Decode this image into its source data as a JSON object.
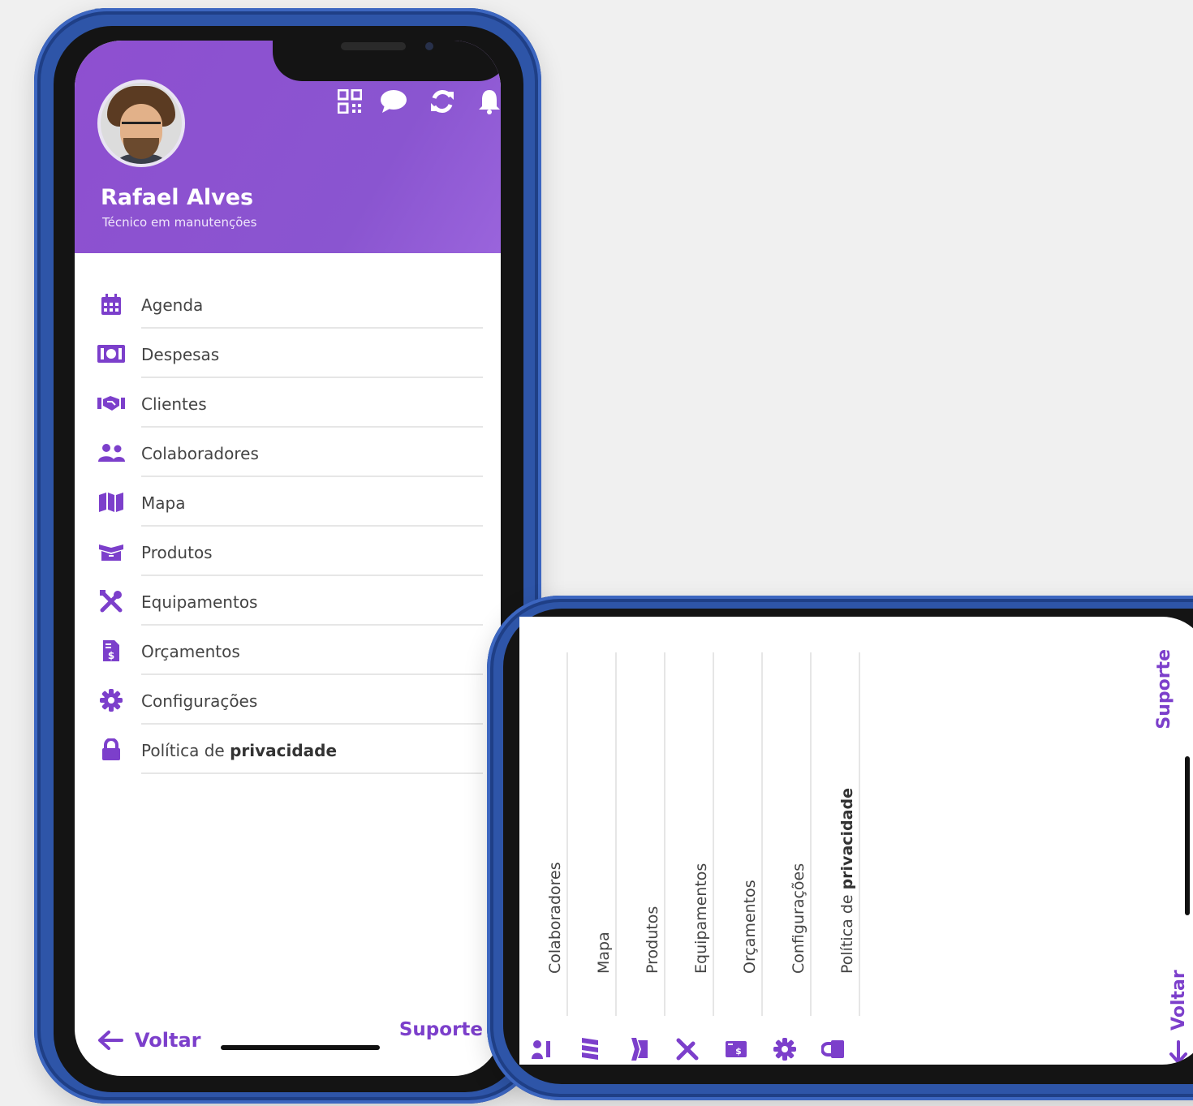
{
  "colors": {
    "accent": "#7c3fcb",
    "header": "#8e4fd0",
    "frame": "#2e55a8"
  },
  "profile": {
    "name": "Rafael Alves",
    "role": "Técnico em manutenções"
  },
  "header_icons": [
    "qr-code-icon",
    "chat-icon",
    "sync-icon",
    "bell-icon"
  ],
  "menu": [
    {
      "label": "Agenda",
      "icon": "calendar-icon"
    },
    {
      "label": "Despesas",
      "icon": "money-icon"
    },
    {
      "label": "Clientes",
      "icon": "handshake-icon"
    },
    {
      "label": "Colaboradores",
      "icon": "users-icon"
    },
    {
      "label": "Mapa",
      "icon": "map-icon"
    },
    {
      "label": "Produtos",
      "icon": "boxes-icon"
    },
    {
      "label": "Equipamentos",
      "icon": "tools-icon"
    },
    {
      "label": "Orçamentos",
      "icon": "invoice-icon"
    },
    {
      "label": "Configurações",
      "icon": "gear-icon"
    },
    {
      "label_plain": "Política de",
      "label_bold": "privacidade",
      "icon": "lock-icon"
    }
  ],
  "footer": {
    "back": "Voltar",
    "support": "Suporte"
  },
  "landscape": {
    "items": [
      {
        "label": "Colaboradores",
        "icon": "users-icon"
      },
      {
        "label": "Mapa",
        "icon": "map-icon"
      },
      {
        "label": "Produtos",
        "icon": "boxes-icon"
      },
      {
        "label": "Equipamentos",
        "icon": "tools-icon"
      },
      {
        "label": "Orçamentos",
        "icon": "invoice-icon"
      },
      {
        "label": "Configurações",
        "icon": "gear-icon"
      },
      {
        "label_plain": "Política de",
        "label_bold": "privacidade",
        "icon": "lock-icon"
      }
    ],
    "back": "Voltar",
    "support": "Suporte"
  }
}
